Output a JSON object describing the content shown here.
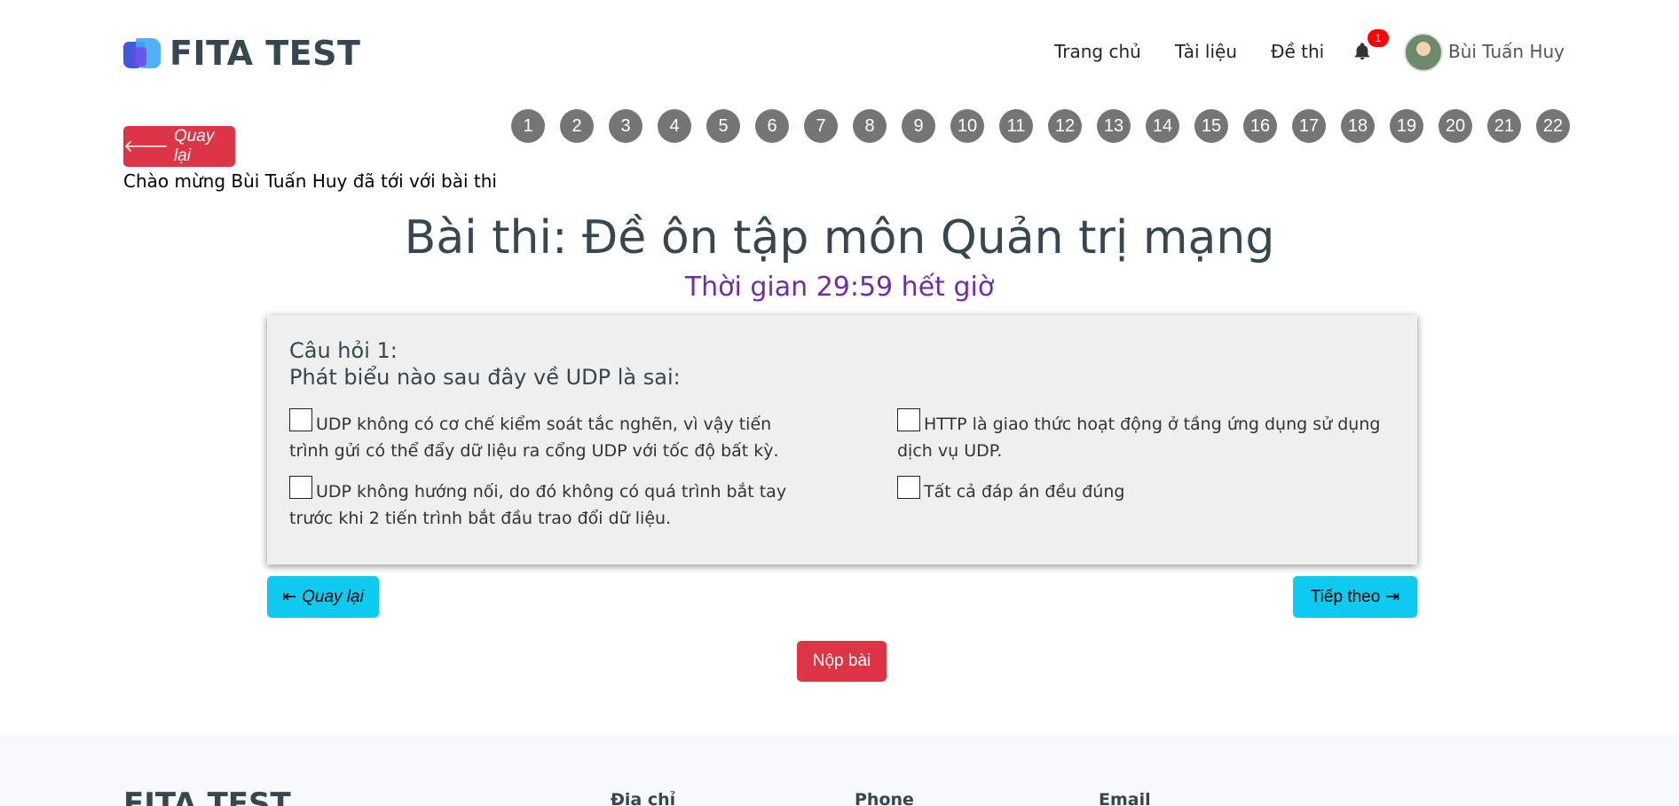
{
  "header": {
    "logo_text": "FITA TEST",
    "nav": [
      "Trang chủ",
      "Tài liệu",
      "Đề thi"
    ],
    "notification_count": "1",
    "username": "Bùi Tuấn Huy"
  },
  "back_top_label": "Quay lại",
  "welcome": "Chào mừng Bùi Tuấn Huy đã tới với bài thi",
  "question_numbers": [
    "1",
    "2",
    "3",
    "4",
    "5",
    "6",
    "7",
    "8",
    "9",
    "10",
    "11",
    "12",
    "13",
    "14",
    "15",
    "16",
    "17",
    "18",
    "19",
    "20",
    "21",
    "22"
  ],
  "exam": {
    "title": "Bài thi: Đề ôn tập môn Quản trị mạng",
    "timer": "Thời gian 29:59 hết giờ"
  },
  "question": {
    "label": "Câu hỏi 1:",
    "text": "Phát biểu nào sau đây về UDP là sai:",
    "options": [
      "UDP không có cơ chế kiểm soát tắc nghẽn, vì vậy tiến trình gửi có thể đẩy dữ liệu ra cổng UDP với tốc độ bất kỳ.",
      "HTTP là giao thức hoạt động ở tầng ứng dụng sử dụng dịch vụ UDP.",
      "UDP không hướng nối, do đó không có quá trình bắt tay trước khi 2 tiến trình bắt đầu trao đổi dữ liệu.",
      "Tất cả đáp án đều đúng"
    ]
  },
  "buttons": {
    "prev": "Quay lại",
    "next": "Tiếp theo",
    "submit": "Nộp bài"
  },
  "footer": {
    "logo_text": "FITA TEST",
    "columns": [
      "Địa chỉ",
      "Phone",
      "Email"
    ]
  },
  "colors": {
    "danger": "#dc3545",
    "info": "#0dcaf0",
    "timer": "#6f2da8",
    "circle": "#757575"
  }
}
